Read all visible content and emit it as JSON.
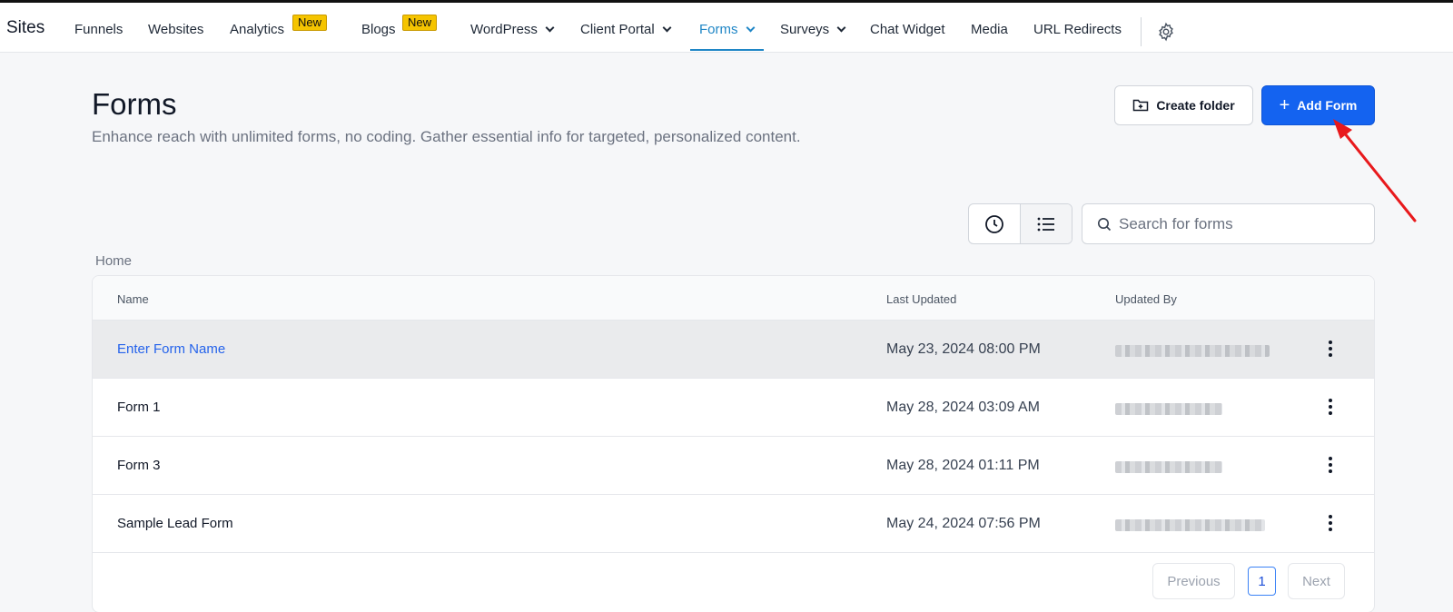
{
  "nav": {
    "brand": "Sites",
    "items": [
      {
        "label": "Funnels"
      },
      {
        "label": "Websites"
      },
      {
        "label": "Analytics",
        "badge": "New"
      },
      {
        "label": "Blogs",
        "badge": "New"
      },
      {
        "label": "WordPress",
        "dropdown": true
      },
      {
        "label": "Client Portal",
        "dropdown": true
      },
      {
        "label": "Forms",
        "dropdown": true,
        "active": true
      },
      {
        "label": "Surveys",
        "dropdown": true
      },
      {
        "label": "Chat Widget"
      },
      {
        "label": "Media"
      },
      {
        "label": "URL Redirects"
      }
    ],
    "settings_icon": "gear-icon"
  },
  "header": {
    "title": "Forms",
    "subtitle": "Enhance reach with unlimited forms, no coding. Gather essential info for targeted, personalized content.",
    "create_folder_label": "Create folder",
    "add_form_label": "Add Form"
  },
  "toolbar": {
    "search_placeholder": "Search for forms",
    "view_recent_icon": "clock-icon",
    "view_list_icon": "list-icon",
    "active_view": "list"
  },
  "breadcrumb": "Home",
  "table": {
    "columns": [
      "Name",
      "Last Updated",
      "Updated By"
    ],
    "rows": [
      {
        "name": "Enter Form Name",
        "last_updated": "May 23, 2024 08:00 PM",
        "updated_by": "(blurred)",
        "highlighted": true
      },
      {
        "name": "Form 1",
        "last_updated": "May 28, 2024 03:09 AM",
        "updated_by": "(blurred)"
      },
      {
        "name": "Form 3",
        "last_updated": "May 28, 2024 01:11 PM",
        "updated_by": "(blurred)"
      },
      {
        "name": "Sample Lead Form",
        "last_updated": "May 24, 2024 07:56 PM",
        "updated_by": "(blurred)"
      }
    ]
  },
  "pagination": {
    "previous_label": "Previous",
    "current_page": "1",
    "next_label": "Next"
  },
  "colors": {
    "accent": "#1463f0",
    "active_nav": "#1f86c6",
    "badge": "#f5c400",
    "annotation_arrow": "#e8191c"
  }
}
